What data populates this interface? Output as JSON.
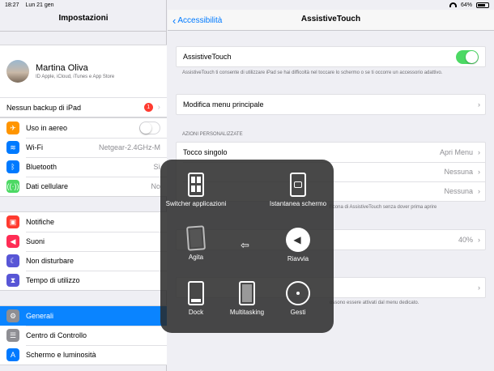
{
  "status": {
    "time": "18:27",
    "date": "Lun 21 gen",
    "battery": "64%"
  },
  "sidebar": {
    "title": "Impostazioni",
    "profile": {
      "name": "Martina Oliva",
      "subtitle": "ID Apple, iCloud, iTunes e App Store"
    },
    "backup": {
      "label": "Nessun backup di iPad",
      "badge": "1"
    },
    "group1": [
      {
        "label": "Uso in aereo",
        "icon": "airplane-icon",
        "color": "#ff9500"
      },
      {
        "label": "Wi-Fi",
        "icon": "wifi-icon",
        "color": "#007aff",
        "value": "Netgear-2.4GHz-M"
      },
      {
        "label": "Bluetooth",
        "icon": "bluetooth-icon",
        "color": "#007aff",
        "value": "Sì"
      },
      {
        "label": "Dati cellulare",
        "icon": "antenna-icon",
        "color": "#4cd964",
        "value": "No"
      }
    ],
    "group2": [
      {
        "label": "Notifiche",
        "icon": "notifications-icon",
        "color": "#ff3b30"
      },
      {
        "label": "Suoni",
        "icon": "speaker-icon",
        "color": "#ff2d55"
      },
      {
        "label": "Non disturbare",
        "icon": "moon-icon",
        "color": "#5856d6"
      },
      {
        "label": "Tempo di utilizzo",
        "icon": "hourglass-icon",
        "color": "#5856d6"
      }
    ],
    "group3": [
      {
        "label": "Generali",
        "icon": "gear-icon",
        "color": "#8e8e93"
      },
      {
        "label": "Centro di Controllo",
        "icon": "toggles-icon",
        "color": "#8e8e93"
      },
      {
        "label": "Schermo e luminosità",
        "icon": "brightness-icon",
        "color": "#007aff"
      }
    ]
  },
  "main": {
    "back_label": "Accessibilità",
    "title": "AssistiveTouch",
    "assistive_label": "AssistiveTouch",
    "assistive_footer": "AssistiveTouch ti consente di utilizzare iPad se hai difficoltà nel toccare lo schermo o se ti occorre un accessorio adattivo.",
    "customize_label": "Modifica menu principale",
    "section_header": "AZIONI PERSONALIZZATE",
    "actions": [
      {
        "label": "Tocco singolo",
        "value": "Apri Menu"
      },
      {
        "label": "",
        "value": "Nessuna"
      },
      {
        "label": "",
        "value": "Nessuna"
      }
    ],
    "actions_footer": "l'icona di AssistiveTouch senza dover prima aprire",
    "opacity_value": "40%",
    "bottom_footer": "ossono essere attivati dal menu dedicato."
  },
  "overlay": {
    "items": [
      {
        "label": "Switcher applicazioni"
      },
      {
        "label": "Istantanea schermo"
      },
      {
        "label": "Agita"
      },
      {
        "label": "Riavvia"
      },
      {
        "label": "Dock"
      },
      {
        "label": "Multitasking"
      },
      {
        "label": "Gesti"
      }
    ]
  }
}
